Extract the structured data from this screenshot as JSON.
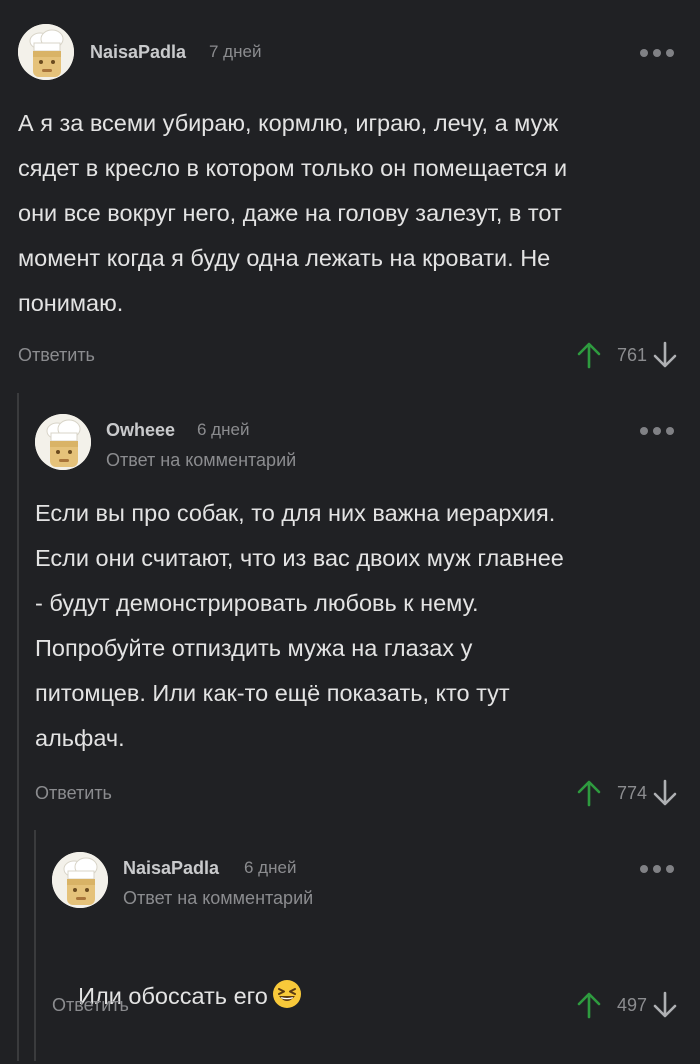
{
  "comments": [
    {
      "author": "NaisaPadla",
      "date": "7 дней",
      "reply_to": "",
      "text": "А я за всеми убираю, кормлю, играю, лечу, а муж\nсядет в кресло в котором только он помещается и\nони все вокруг него, даже на голову залезут, в тот\nмомент когда я буду одна лежать на кровати. Не\nпонимаю.",
      "reply_label": "Ответить",
      "rating": "761"
    },
    {
      "author": "Owheee",
      "date": "6 дней",
      "reply_to": "Ответ на комментарий",
      "text": "Если вы про собак, то для них важна иерархия.\nЕсли они считают, что из вас двоих муж главнее\n- будут демонстрировать любовь к нему.\nПопробуйте отпиздить мужа на глазах у\nпитомцев. Или как-то ещё показать, кто тут\nальфач.",
      "reply_label": "Ответить",
      "rating": "774"
    },
    {
      "author": "NaisaPadla",
      "date": "6 дней",
      "reply_to": "Ответ на комментарий",
      "text": "Или обоссать его",
      "emoji": "grinning-squinting-face",
      "reply_label": "Ответить",
      "rating": "497"
    }
  ],
  "colors": {
    "background": "#202124",
    "upvote": "#2e9b3f",
    "muted": "#8b8c8f"
  },
  "icons": {
    "upvote": "arrow-up-icon",
    "downvote": "arrow-down-icon",
    "more": "more-dots-icon",
    "avatar": "chef-avatar"
  }
}
